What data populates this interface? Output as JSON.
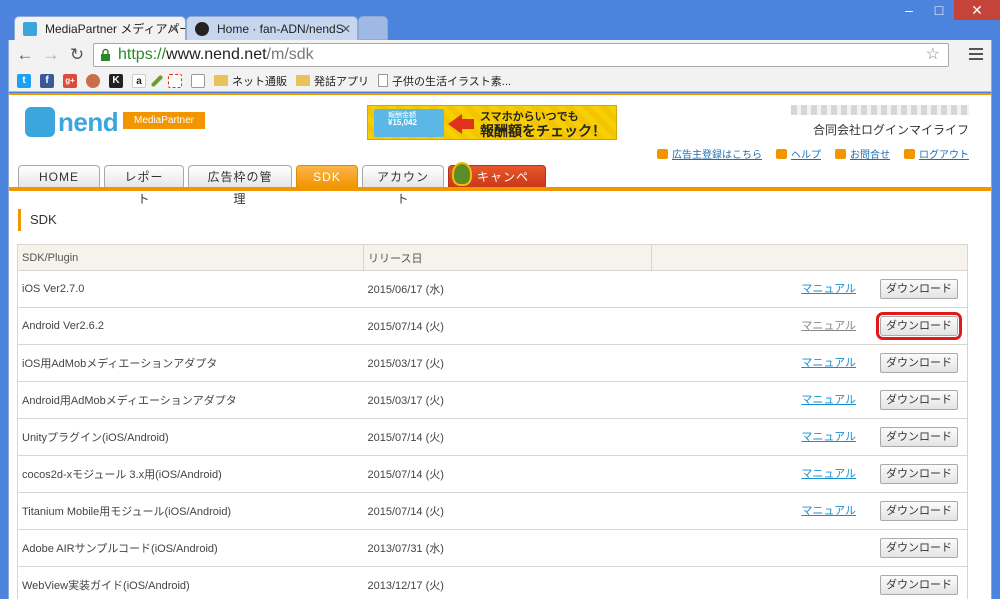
{
  "browser": {
    "tabs": [
      {
        "label": "MediaPartner メディアパー",
        "active": true
      },
      {
        "label": "Home · fan-ADN/nendS",
        "active": false
      }
    ],
    "url": {
      "scheme": "https://",
      "host": "www.nend.net",
      "path": "/m/sdk"
    },
    "bookmarks": [
      {
        "type": "icon",
        "icon": "twitter-icon",
        "color": "#1da1f2",
        "glyph": "t"
      },
      {
        "type": "icon",
        "icon": "facebook-icon",
        "color": "#3b5998",
        "glyph": "f"
      },
      {
        "type": "icon",
        "icon": "google-plus-icon",
        "color": "#dd4b39",
        "glyph": "g+"
      },
      {
        "type": "icon",
        "icon": "avatar-icon",
        "color": "#c96f4a",
        "glyph": ""
      },
      {
        "type": "icon",
        "icon": "k-icon",
        "color": "#222",
        "glyph": "K"
      },
      {
        "type": "icon",
        "icon": "amazon-icon",
        "color": "#ffffff",
        "glyph": "a"
      },
      {
        "type": "icon",
        "icon": "pen-icon",
        "color": "#6a9e2b",
        "glyph": ""
      },
      {
        "type": "icon",
        "icon": "doc-icon",
        "color": "#e0301e",
        "glyph": ""
      },
      {
        "type": "icon",
        "icon": "mail-icon",
        "color": "#ffffff",
        "glyph": ""
      }
    ],
    "bookmark_items": [
      {
        "icon": "folder-icon",
        "label": "ネット通販"
      },
      {
        "icon": "folder-icon",
        "label": "発話アプリ"
      },
      {
        "icon": "page-icon",
        "label": "子供の生活イラスト素..."
      }
    ]
  },
  "header": {
    "logo": "nend",
    "badge": "MediaPartner",
    "banner": {
      "line1": "スマホからいつでも",
      "line2": "報酬額をチェック！",
      "card_label": "報酬金額",
      "card_amount": "¥15,042"
    },
    "company": "合同会社ログインマイライフ",
    "links": [
      "広告主登録はこちら",
      "ヘルプ",
      "お問合せ",
      "ログアウト"
    ]
  },
  "nav": {
    "tabs": [
      {
        "label": "HOME",
        "active": false
      },
      {
        "label": "レポート",
        "active": false
      },
      {
        "label": "広告枠の管理",
        "active": false
      },
      {
        "label": "SDK",
        "active": true
      },
      {
        "label": "アカウント",
        "active": false
      },
      {
        "label": "キャンペーン",
        "active": false,
        "campaign": true
      }
    ]
  },
  "section": {
    "title": "SDK"
  },
  "table": {
    "headers": [
      "SDK/Plugin",
      "リリース日",
      ""
    ],
    "manual_label": "マニュアル",
    "download_label": "ダウンロード",
    "rows": [
      {
        "name": "iOS Ver2.7.0",
        "date": "2015/06/17 (水)",
        "manual": true,
        "highlight": false
      },
      {
        "name": "Android Ver2.6.2",
        "date": "2015/07/14 (火)",
        "manual": true,
        "manual_gray": true,
        "highlight": true
      },
      {
        "name": "iOS用AdMobメディエーションアダプタ",
        "date": "2015/03/17 (火)",
        "manual": true,
        "highlight": false
      },
      {
        "name": "Android用AdMobメディエーションアダプタ",
        "date": "2015/03/17 (火)",
        "manual": true,
        "highlight": false
      },
      {
        "name": "Unityプラグイン(iOS/Android)",
        "date": "2015/07/14 (火)",
        "manual": true,
        "highlight": false
      },
      {
        "name": "cocos2d-xモジュール 3.x用(iOS/Android)",
        "date": "2015/07/14 (火)",
        "manual": true,
        "highlight": false
      },
      {
        "name": "Titanium Mobile用モジュール(iOS/Android)",
        "date": "2015/07/14 (火)",
        "manual": true,
        "highlight": false
      },
      {
        "name": "Adobe AIRサンプルコード(iOS/Android)",
        "date": "2013/07/31 (水)",
        "manual": false,
        "highlight": false
      },
      {
        "name": "WebView実装ガイド(iOS/Android)",
        "date": "2013/12/17 (火)",
        "manual": false,
        "highlight": false
      }
    ]
  }
}
